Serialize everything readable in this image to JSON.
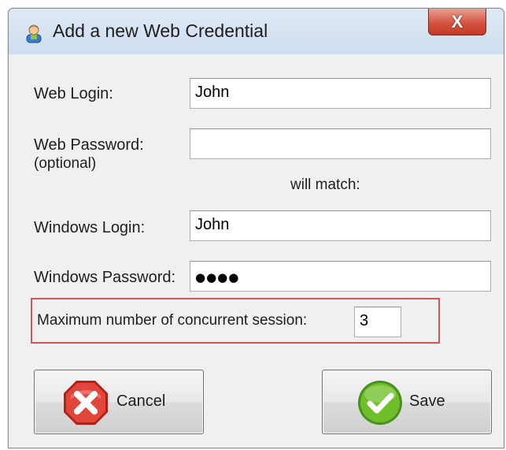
{
  "window": {
    "title": "Add a new Web Credential",
    "close_label": "X"
  },
  "icons": {
    "title": "user-icon",
    "close": "close-icon",
    "cancel": "cancel-x-icon",
    "save": "save-check-icon"
  },
  "form": {
    "web_login": {
      "label": "Web Login:",
      "value": "John"
    },
    "web_password": {
      "label": "Web Password:",
      "sublabel": "(optional)",
      "value": ""
    },
    "match_text": "will match:",
    "windows_login": {
      "label": "Windows Login:",
      "value": "John"
    },
    "windows_password": {
      "label": "Windows Password:",
      "value": "●●●●"
    },
    "max_sessions": {
      "label": "Maximum number of concurrent session:",
      "value": "3"
    }
  },
  "buttons": {
    "cancel": "Cancel",
    "save": "Save"
  },
  "colors": {
    "title_bar": "#cdddf0",
    "close_button": "#d5533f",
    "highlight_border": "#d9535b",
    "cancel_icon": "#e2463b",
    "save_icon": "#6fbf2a",
    "window_bg": "#f0f0f0"
  }
}
